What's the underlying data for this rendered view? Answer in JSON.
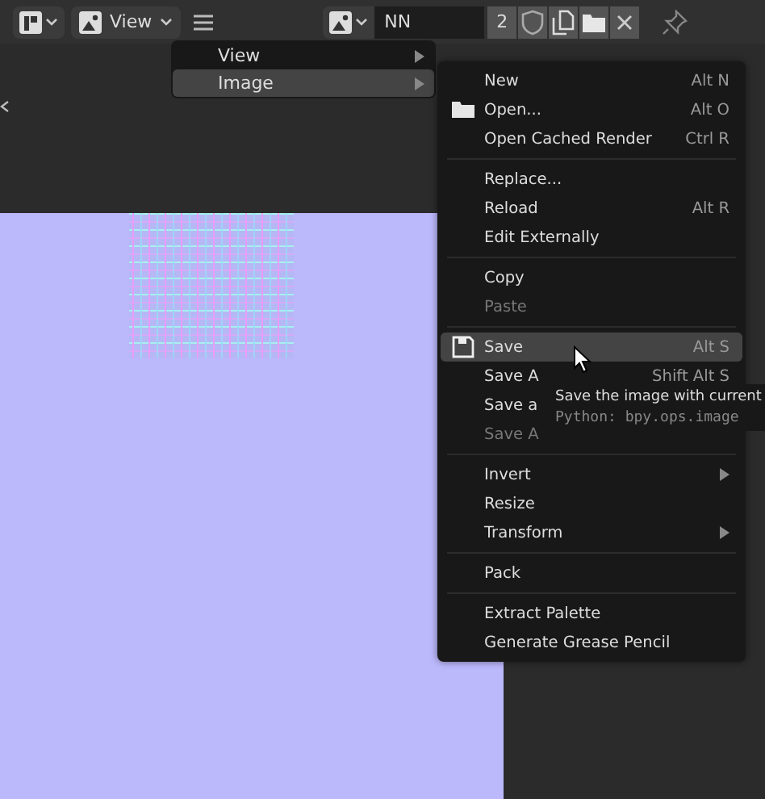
{
  "header": {
    "view_menu": "View",
    "image_name": "NN",
    "users": "2"
  },
  "main_menu": [
    {
      "label": "View",
      "selected": false,
      "submenu": true
    },
    {
      "label": "Image",
      "selected": true,
      "submenu": true
    }
  ],
  "image_menu": [
    [
      {
        "label": "New",
        "shortcut": "Alt N",
        "disabled": false,
        "selected": false
      },
      {
        "label": "Open...",
        "shortcut": "Alt O",
        "disabled": false,
        "selected": false,
        "kind": "with_icon"
      },
      {
        "label": "Open Cached Render",
        "shortcut": "Ctrl R",
        "disabled": false,
        "selected": false
      }
    ],
    [
      {
        "label": "Replace...",
        "disabled": false,
        "selected": false
      },
      {
        "label": "Reload",
        "shortcut": "Alt R",
        "disabled": false,
        "selected": false
      },
      {
        "label": "Edit Externally",
        "disabled": false,
        "selected": false
      }
    ],
    [
      {
        "label": "Copy",
        "disabled": false,
        "selected": false
      },
      {
        "label": "Paste",
        "disabled": true,
        "selected": false
      }
    ],
    [
      {
        "label": "Save",
        "shortcut": "Alt S",
        "disabled": false,
        "selected": true,
        "kind": "with_icon"
      },
      {
        "label": "Save A",
        "shortcut": "Shift Alt S",
        "disabled": false,
        "selected": false
      },
      {
        "label": "Save a",
        "disabled": false,
        "selected": false
      },
      {
        "label": "Save A",
        "disabled": true,
        "selected": false
      }
    ],
    [
      {
        "label": "Invert",
        "disabled": false,
        "selected": false,
        "submenu": true
      },
      {
        "label": "Resize",
        "disabled": false,
        "selected": false
      },
      {
        "label": "Transform",
        "disabled": false,
        "selected": false,
        "submenu": true
      }
    ],
    [
      {
        "label": "Pack",
        "disabled": false,
        "selected": false
      }
    ],
    [
      {
        "label": "Extract Palette",
        "disabled": false,
        "selected": false
      },
      {
        "label": "Generate Grease Pencil",
        "disabled": false,
        "selected": false
      }
    ]
  ],
  "tooltip": {
    "title": "Save the image with current",
    "python": "Python: bpy.ops.image"
  }
}
